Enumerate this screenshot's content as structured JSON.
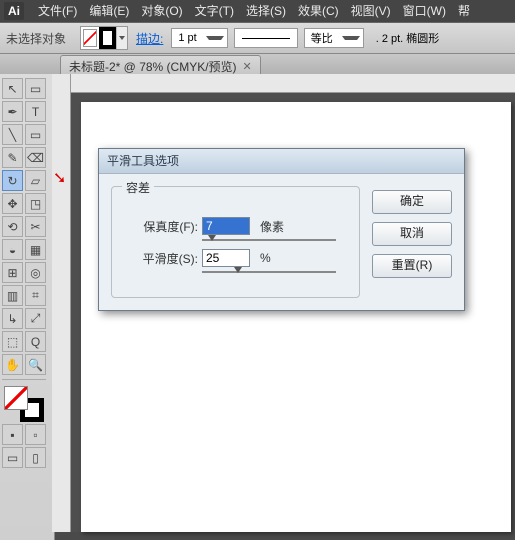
{
  "menu": {
    "logo": "Ai",
    "items": [
      "文件(F)",
      "编辑(E)",
      "对象(O)",
      "文字(T)",
      "选择(S)",
      "效果(C)",
      "视图(V)",
      "窗口(W)",
      "帮"
    ]
  },
  "optbar": {
    "noSelection": "未选择对象",
    "strokeLabel": "描边:",
    "strokeWeight": "1 pt",
    "uniform": "等比",
    "opacity": ". 2 pt. 椭圆形"
  },
  "docTab": {
    "title": "未标题-2* @ 78% (CMYK/预览)"
  },
  "tools": [
    "↖",
    "▭",
    "✒",
    "T",
    "╲",
    "▭",
    "✎",
    "⌫",
    "↻",
    "▱",
    "✥",
    "◳",
    "⟲",
    "✂",
    "◒",
    "▦",
    "⊞",
    "◎",
    "▥",
    "⌗",
    "↳",
    "⤢",
    "⬚",
    "Q",
    "✋",
    "🔍"
  ],
  "dialog": {
    "title": "平滑工具选项",
    "group": "容差",
    "fidelityLabel": "保真度(F):",
    "fidelityVal": "7",
    "fidelityUnit": "像素",
    "smoothLabel": "平滑度(S):",
    "smoothVal": "25",
    "smoothUnit": "%",
    "ok": "确定",
    "cancel": "取消",
    "reset": "重置(R)"
  }
}
